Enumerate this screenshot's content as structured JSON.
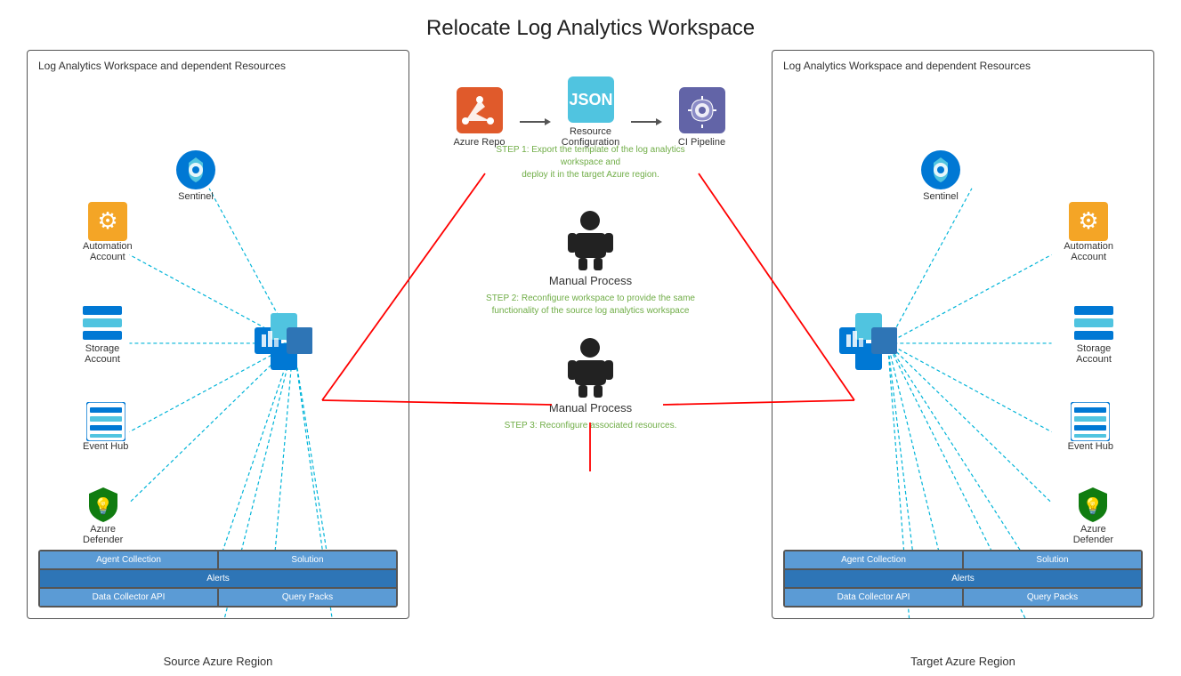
{
  "title": "Relocate Log Analytics Workspace",
  "left_box": {
    "label": "Log Analytics Workspace and dependent Resources",
    "region": "Source Azure Region",
    "icons": {
      "sentinel": "Sentinel",
      "automation": "Automation\nAccount",
      "storage": "Storage\nAccount",
      "event_hub": "Event Hub",
      "azure_defender": "Azure\nDefender"
    },
    "table": {
      "rows": [
        [
          "Agent Collection",
          "Solution"
        ],
        [
          "Alerts"
        ],
        [
          "Data Collector API",
          "Query Packs"
        ]
      ]
    }
  },
  "right_box": {
    "label": "Log Analytics Workspace and dependent Resources",
    "region": "Target Azure Region",
    "icons": {
      "sentinel": "Sentinel",
      "automation": "Automation\nAccount",
      "storage": "Storage\nAccount",
      "event_hub": "Event Hub",
      "azure_defender": "Azure\nDefender"
    },
    "table": {
      "rows": [
        [
          "Agent Collection",
          "Solution"
        ],
        [
          "Alerts"
        ],
        [
          "Data Collector API",
          "Query Packs"
        ]
      ]
    }
  },
  "center": {
    "pipeline": {
      "azure_repo": "Azure Repo",
      "resource_config": "Resource\nConfiguration",
      "ci_pipeline": "CI Pipeline"
    },
    "steps": [
      {
        "label": "STEP 1: Export the template of the log analytics workspace and\ndeploy it in the target Azure region.",
        "process": null
      },
      {
        "label": "Manual Process",
        "step_text": "STEP 2: Reconfigure workspace to provide the same\nfunctionality of the source log analytics workspace"
      },
      {
        "label": "Manual Process",
        "step_text": "STEP 3: Reconfigure associated resources."
      }
    ]
  },
  "colors": {
    "accent_blue": "#2e75b6",
    "light_blue": "#5b9bd5",
    "green_text": "#70ad47",
    "red_line": "#ff0000",
    "sentinel_blue": "#0078d4",
    "border": "#555555"
  }
}
